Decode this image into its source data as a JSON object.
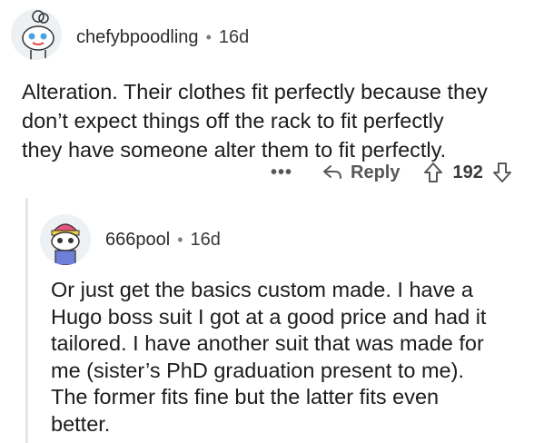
{
  "comments": [
    {
      "username": "chefybpoodling",
      "separator": "•",
      "age": "16d",
      "text": "Alteration. Their clothes fit perfectly because they\ndon’t expect things off the rack to fit perfectly\nthey have someone alter them to fit perfectly.",
      "more_label": "•••",
      "reply_label": "Reply",
      "score": "192"
    },
    {
      "username": "666pool",
      "separator": "•",
      "age": "16d",
      "text": "Or just get the basics custom made. I have a\nHugo boss suit I got at a good price and had it\ntailored. I have another suit that was made for\nme (sister’s PhD graduation present to me).\nThe former fits fine but the latter fits even\nbetter."
    }
  ],
  "colors": {
    "text": "#1c1c1c",
    "meta": "#575757",
    "avatar_bg": "#eef1f3",
    "thread_line": "#e6e6e6"
  },
  "icons": [
    "snoo-avatar-chef",
    "snoo-avatar-beanie",
    "reply-arrow-icon",
    "upvote-icon",
    "downvote-icon"
  ]
}
